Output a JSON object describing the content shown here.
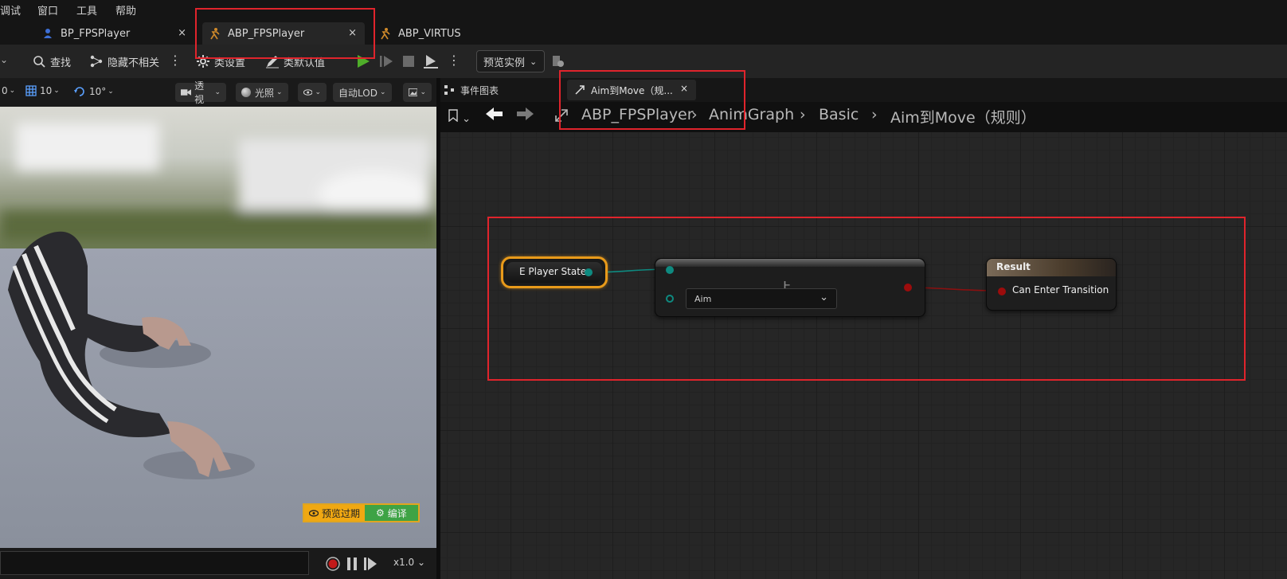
{
  "menu": [
    "调试",
    "窗口",
    "工具",
    "帮助"
  ],
  "tabs": [
    {
      "label": "BP_FPSPlayer",
      "icon": "blueprint-character-icon",
      "close": "×"
    },
    {
      "label": "ABP_FPSPlayer",
      "icon": "anim-blueprint-icon",
      "close": "×"
    },
    {
      "label": "ABP_VIRTUS",
      "icon": "anim-blueprint-icon"
    }
  ],
  "toolbar": {
    "find": "查找",
    "hide_unrelated": "隐藏不相关",
    "class_settings": "类设置",
    "class_defaults": "类默认值",
    "preview_instance": "预览实例"
  },
  "viewport_toolbar": {
    "grid_value": "0",
    "snap_grid": "10",
    "snap_rotation": "10°",
    "view_mode": "透视",
    "lighting": "光照",
    "lod": "自动LOD"
  },
  "viewport": {
    "preview_expired": "预览过期",
    "compile": "编译"
  },
  "timeline": {
    "speed": "x1.0"
  },
  "graph_tabs": [
    {
      "label": "事件图表",
      "icon": "event-graph-icon"
    },
    {
      "label": "Aim到Move（规...",
      "icon": "transition-rule-icon",
      "close": "×"
    }
  ],
  "breadcrumb": [
    "ABP_FPSPlayer",
    "AnimGraph",
    "Basic",
    "Aim到Move（规则）"
  ],
  "nodes": {
    "player_state": {
      "label": "E Player State"
    },
    "enum_equal": {
      "dropdown_value": "Aim"
    },
    "result": {
      "title": "Result",
      "pin_label": "Can Enter Transition"
    }
  },
  "colors": {
    "accent_red": "#e0242c",
    "enum_pin": "#0e8a80",
    "bool_pin": "#9c0c0c",
    "selection_outline": "#e89a1a",
    "play_green": "#4fae2a",
    "compile_green": "#3ea345",
    "warning_yellow": "#f0a812"
  }
}
